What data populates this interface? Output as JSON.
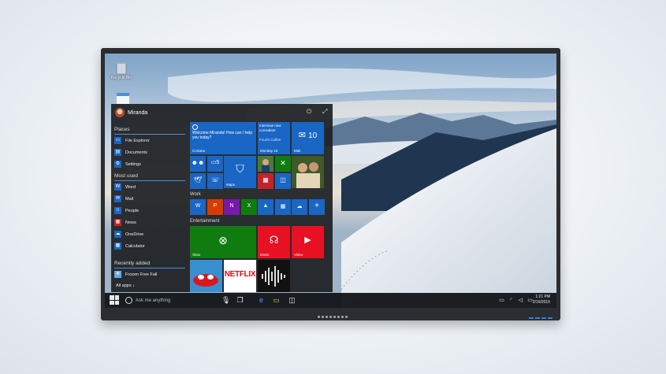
{
  "desktop": {
    "recycle_bin_label": "Recycle Bin"
  },
  "start": {
    "user_name": "Miranda",
    "power_icon": "power-icon",
    "expand_icon": "expand-icon",
    "places_heading": "Places",
    "places": [
      {
        "label": "File Explorer",
        "icon": "folder-icon"
      },
      {
        "label": "Documents",
        "icon": "documents-icon"
      },
      {
        "label": "Settings",
        "icon": "gear-icon"
      }
    ],
    "most_used_heading": "Most used",
    "most_used": [
      {
        "label": "Word",
        "icon": "word-icon"
      },
      {
        "label": "Mail",
        "icon": "mail-icon"
      },
      {
        "label": "People",
        "icon": "people-icon"
      },
      {
        "label": "News",
        "icon": "news-icon"
      },
      {
        "label": "OneDrive",
        "icon": "cloud-icon"
      },
      {
        "label": "Calculator",
        "icon": "calculator-icon"
      }
    ],
    "recently_added_heading": "Recently added",
    "recently_added": [
      {
        "label": "Frozen Free Fall",
        "icon": "frozen-icon"
      }
    ],
    "all_apps": "All apps ↓"
  },
  "tiles": {
    "cortana_text": "Welcome Miranda! How can I help you today?",
    "cortana_label": "Cortana",
    "calendar_text": "Interview new consultant",
    "calendar_sub": "Fourth Coffee",
    "calendar_label": "Monday 16",
    "mail_count": "10",
    "mail_label": "Mail",
    "people_badge": "5",
    "maps_label": "Maps",
    "work_heading": "Work",
    "entertainment_heading": "Entertainment",
    "xbox_label": "Xbox",
    "music_label": "Music",
    "video_label": "Video",
    "netflix_label": "NETFLIX"
  },
  "taskbar": {
    "search_placeholder": "Ask me anything",
    "time": "1:21 PM",
    "date": "2/16/2015"
  },
  "colors": {
    "accent": "#1a66c4",
    "tile_red": "#e81123",
    "tile_green": "#107c10",
    "tile_orange": "#d83b01",
    "taskbar": "#14161a"
  }
}
